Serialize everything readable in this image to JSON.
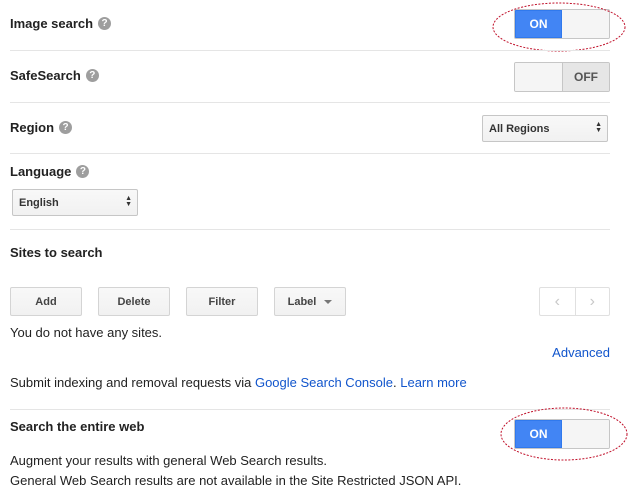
{
  "image_search": {
    "label": "Image search",
    "toggle_on": "ON"
  },
  "safesearch": {
    "label": "SafeSearch",
    "toggle_off": "OFF"
  },
  "region": {
    "label": "Region",
    "selected": "All Regions"
  },
  "language": {
    "label": "Language",
    "selected": "English"
  },
  "sites": {
    "heading": "Sites to search",
    "buttons": {
      "add": "Add",
      "delete": "Delete",
      "filter": "Filter",
      "label": "Label"
    },
    "empty_text": "You do not have any sites.",
    "advanced_link": "Advanced"
  },
  "indexing": {
    "prefix": "Submit indexing and removal requests via ",
    "console_link": "Google Search Console",
    "separator": ". ",
    "learn_more": "Learn more"
  },
  "entire_web": {
    "label": "Search the entire web",
    "toggle_on": "ON",
    "description1": "Augment your results with general Web Search results.",
    "description2": "General Web Search results are not available in the Site Restricted JSON API."
  },
  "colors": {
    "accent": "#4285f4",
    "link": "#1155cc",
    "annotation": "#c0102a"
  }
}
